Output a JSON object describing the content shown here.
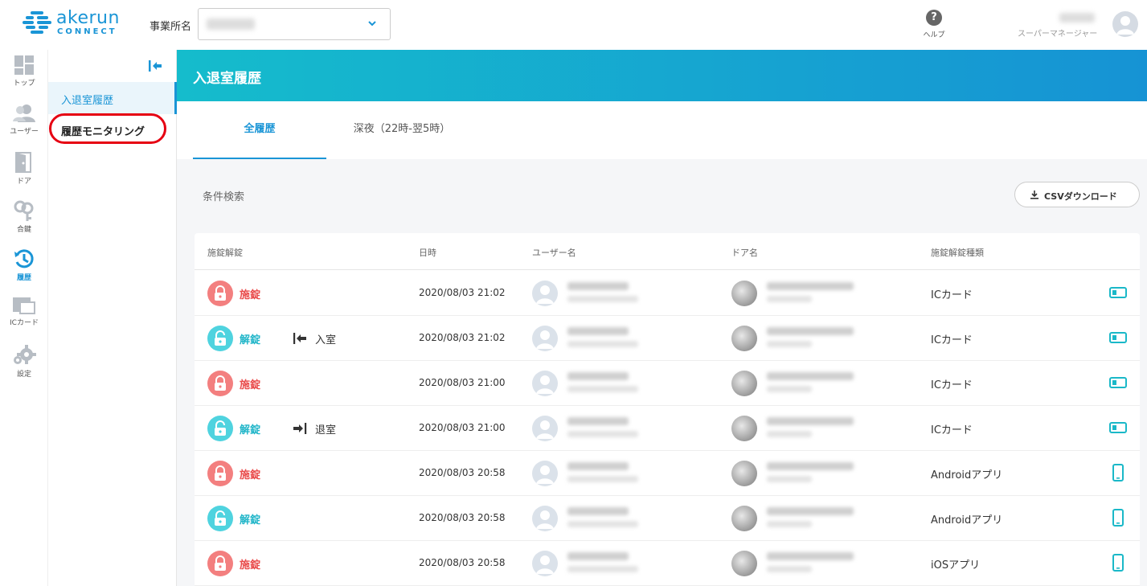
{
  "header": {
    "logo_text": "akerun",
    "logo_sub": "CONNECT",
    "office_label": "事業所名",
    "help_label": "ヘルプ",
    "user_role": "スーパーマネージャー"
  },
  "rail": {
    "items": [
      {
        "label": "トップ",
        "icon": "grid-icon"
      },
      {
        "label": "ユーザー",
        "icon": "users-icon"
      },
      {
        "label": "ドア",
        "icon": "door-icon"
      },
      {
        "label": "合鍵",
        "icon": "key-icon"
      },
      {
        "label": "履歴",
        "icon": "history-icon"
      },
      {
        "label": "ICカード",
        "icon": "card-icon"
      },
      {
        "label": "設定",
        "icon": "gear-icon"
      }
    ]
  },
  "submenu": {
    "item1": "入退室履歴",
    "item2": "履歴モニタリング"
  },
  "page": {
    "title": "入退室履歴",
    "tabs": [
      "全履歴",
      "深夜（22時-翌5時）"
    ],
    "filter_label": "条件検索",
    "csv_button": "CSVダウンロード"
  },
  "table": {
    "columns": [
      "施錠解錠",
      "日時",
      "ユーザー名",
      "ドア名",
      "施錠解錠種類"
    ],
    "rows": [
      {
        "status": "施錠",
        "kind": "lock",
        "direction": "",
        "datetime": "2020/08/03 21:02",
        "type": "ICカード",
        "device": "card-toggle-icon"
      },
      {
        "status": "解錠",
        "kind": "unlock",
        "direction": "入室",
        "datetime": "2020/08/03 21:02",
        "type": "ICカード",
        "device": "card-toggle-icon"
      },
      {
        "status": "施錠",
        "kind": "lock",
        "direction": "",
        "datetime": "2020/08/03 21:00",
        "type": "ICカード",
        "device": "card-toggle-icon"
      },
      {
        "status": "解錠",
        "kind": "unlock",
        "direction": "退室",
        "datetime": "2020/08/03 21:00",
        "type": "ICカード",
        "device": "card-toggle-icon"
      },
      {
        "status": "施錠",
        "kind": "lock",
        "direction": "",
        "datetime": "2020/08/03 20:58",
        "type": "Androidアプリ",
        "device": "phone-icon"
      },
      {
        "status": "解錠",
        "kind": "unlock",
        "direction": "",
        "datetime": "2020/08/03 20:58",
        "type": "Androidアプリ",
        "device": "phone-icon"
      },
      {
        "status": "施錠",
        "kind": "lock",
        "direction": "",
        "datetime": "2020/08/03 20:58",
        "type": "iOSアプリ",
        "device": "phone-icon"
      }
    ]
  },
  "colors": {
    "accent": "#1a95d6",
    "lock": "#e94b4b",
    "unlock": "#22b6c9",
    "highlight": "#e60012"
  }
}
